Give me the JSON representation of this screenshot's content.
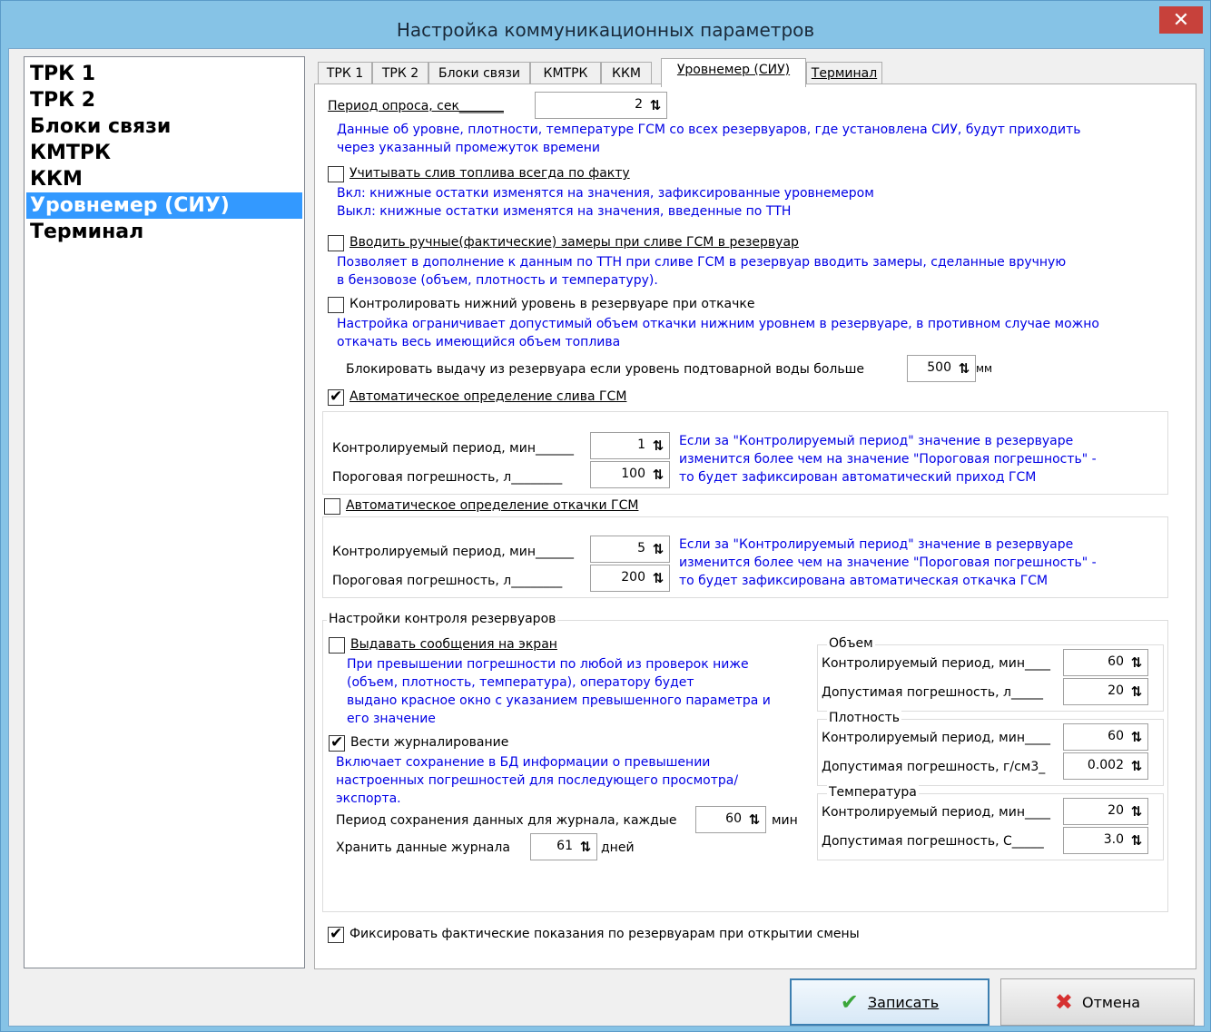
{
  "window": {
    "title": "Настройка коммуникационных параметров",
    "close_symbol": "✕"
  },
  "nav": {
    "items": [
      {
        "label": "ТРК 1"
      },
      {
        "label": "ТРК 2"
      },
      {
        "label": "Блоки связи"
      },
      {
        "label": "КМТРК"
      },
      {
        "label": "ККМ"
      },
      {
        "label": "Уровнемер (СИУ)",
        "selected": true
      },
      {
        "label": "Терминал"
      }
    ]
  },
  "tabs": [
    {
      "label": "ТРК 1"
    },
    {
      "label": "ТРК 2"
    },
    {
      "label": "Блоки связи"
    },
    {
      "label": "КМТРК"
    },
    {
      "label": "ККМ"
    },
    {
      "label": "Уровнемер (СИУ)",
      "active": true
    },
    {
      "label": "Терминал"
    }
  ],
  "poll": {
    "label": "Период опроса, сек_______",
    "value": "2",
    "desc1": "Данные об уровне, плотности, температуре ГСМ со всех резервуаров, где установлена СИУ, будут приходить",
    "desc2": "через указанный промежуток времени"
  },
  "fact_drain": {
    "label": "Учитывать слив топлива всегда по факту",
    "checked": false,
    "desc1": "Вкл: книжные остатки изменятся на значения, зафиксированные уровнемером",
    "desc2": "Выкл: книжные остатки изменятся на значения, введенные по ТТН"
  },
  "manual_measure": {
    "label": "Вводить ручные(фактические) замеры при сливе ГСМ в резервуар",
    "checked": false,
    "desc1": "Позволяет в дополнение к данным по ТТН при сливе ГСМ в резервуар вводить замеры, сделанные вручную",
    "desc2": "в бензовозе (объем, плотность и температуру)."
  },
  "low_level": {
    "label": "Контролировать нижний уровень в резервуаре при откачке",
    "checked": false,
    "desc1": "Настройка ограничивает допустимый объем откачки нижним уровнем в резервуаре, в противном случае можно",
    "desc2": "откачать весь имеющийся объем топлива"
  },
  "water_block": {
    "label": "Блокировать выдачу из резервуара если уровень подтоварной воды больше",
    "value": "500",
    "unit": "мм"
  },
  "auto_drain": {
    "label": "Автоматическое определение слива ГСМ",
    "checked": true,
    "period_label": "Контролируемый период, мин______",
    "period_value": "1",
    "threshold_label": "Пороговая погрешность, л________",
    "threshold_value": "100",
    "note1": "Если за \"Контролируемый период\" значение в резервуаре",
    "note2": "изменится более чем на значение \"Пороговая погрешность\" -",
    "note3": "то будет зафиксирован автоматический приход ГСМ"
  },
  "auto_pump": {
    "label": "Автоматическое определение откачки ГСМ",
    "checked": false,
    "period_label": "Контролируемый период, мин______",
    "period_value": "5",
    "threshold_label": "Пороговая погрешность, л________",
    "threshold_value": "200",
    "note1": "Если за \"Контролируемый период\" значение в резервуаре",
    "note2": "изменится более чем на значение \"Пороговая погрешность\" -",
    "note3": "то будет зафиксирована автоматическая откачка ГСМ"
  },
  "tank_control": {
    "title": "Настройки контроля резервуаров",
    "messages": {
      "label": "Выдавать сообщения на экран",
      "checked": false,
      "desc1": "При превышении погрешности по любой из проверок ниже",
      "desc2": "(объем, плотность, температура), оператору будет",
      "desc3": "выдано красное окно с указанием превышенного параметра и",
      "desc4": "его значение"
    },
    "journal": {
      "label": "Вести журналирование",
      "checked": true,
      "desc1": "Включает сохранение в БД информации о превышении",
      "desc2": "настроенных погрешностей для последующего просмотра/",
      "desc3": "экспорта.",
      "save_label": "Период сохранения данных для журнала, каждые",
      "save_value": "60",
      "save_unit": "мин",
      "keep_label": "Хранить данные журнала",
      "keep_value": "61",
      "keep_unit": "дней"
    },
    "volume": {
      "title": "Объем",
      "period_label": "Контролируемый период, мин____",
      "period_value": "60",
      "err_label": "Допустимая погрешность, л_____",
      "err_value": "20"
    },
    "density": {
      "title": "Плотность",
      "period_label": "Контролируемый период, мин____",
      "period_value": "60",
      "err_label": "Допустимая погрешность, г/см3_",
      "err_value": "0.002"
    },
    "temperature": {
      "title": "Температура",
      "period_label": "Контролируемый период, мин____",
      "period_value": "20",
      "err_label": "Допустимая погрешность, С_____",
      "err_value": "3.0"
    }
  },
  "fix_readings": {
    "label": "Фиксировать фактические показания по резервуарам при открытии смены",
    "checked": true
  },
  "buttons": {
    "save": "Записать",
    "cancel": "Отмена"
  },
  "spin_arrow": "⇅"
}
